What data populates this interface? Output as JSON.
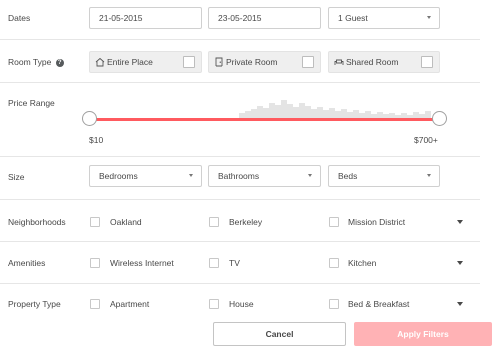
{
  "dates": {
    "label": "Dates",
    "checkin": "21-05-2015",
    "checkout": "23-05-2015",
    "guests": "1 Guest"
  },
  "room_type": {
    "label": "Room Type",
    "help": "?",
    "options": [
      "Entire Place",
      "Private Room",
      "Shared Room"
    ]
  },
  "price_range": {
    "label": "Price Range",
    "min_label": "$10",
    "max_label": "$700+",
    "accent": "#ff5a5f"
  },
  "size": {
    "label": "Size",
    "bedrooms": "Bedrooms",
    "bathrooms": "Bathrooms",
    "beds": "Beds"
  },
  "neighborhoods": {
    "label": "Neighborhoods",
    "options": [
      "Oakland",
      "Berkeley",
      "Mission District"
    ]
  },
  "amenities": {
    "label": "Amenities",
    "options": [
      "Wireless Internet",
      "TV",
      "Kitchen"
    ]
  },
  "property_type": {
    "label": "Property Type",
    "options": [
      "Apartment",
      "House",
      "Bed & Breakfast"
    ]
  },
  "actions": {
    "cancel": "Cancel",
    "apply": "Apply Filters",
    "apply_color": "#ffb2b5"
  }
}
